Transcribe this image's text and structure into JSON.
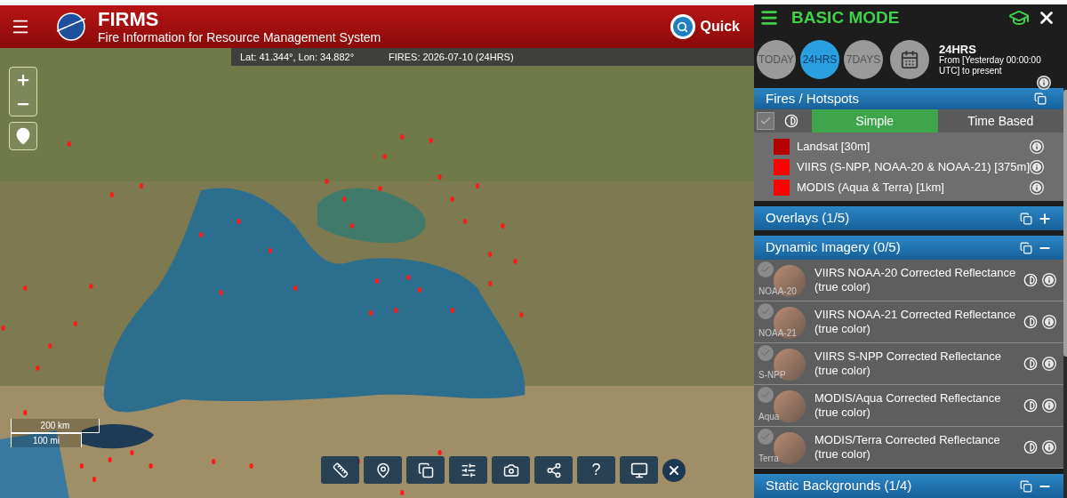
{
  "header": {
    "title": "FIRMS",
    "subtitle": "Fire Information for Resource Management System",
    "quick_search": "Quick"
  },
  "status": {
    "coords": "Lat: 41.344°, Lon: 34.882°",
    "fires": "FIRES: 2026-07-10 (24HRS)"
  },
  "scale": {
    "km": "200 km",
    "mi": "100 mi"
  },
  "toolbar": {
    "help_label": "?"
  },
  "panel": {
    "title": "BASIC MODE",
    "ranges": [
      {
        "label": "TODAY",
        "selected": false
      },
      {
        "label": "24HRS",
        "selected": true
      },
      {
        "label": "7DAYS",
        "selected": false
      }
    ],
    "range_title": "24HRS",
    "range_desc": "From [Yesterday 00:00:00 UTC] to present",
    "fires": {
      "title": "Fires / Hotspots",
      "checked": false,
      "modes": [
        {
          "label": "Simple",
          "selected": true
        },
        {
          "label": "Time Based",
          "selected": false
        }
      ],
      "layers": [
        {
          "name": "Landsat [30m]",
          "color": "#b30000"
        },
        {
          "name": "VIIRS (S-NPP, NOAA-20 & NOAA-21) [375m]",
          "color": "#ff0000"
        },
        {
          "name": "MODIS (Aqua & Terra) [1km]",
          "color": "#ff0000"
        }
      ]
    },
    "sections": [
      {
        "title": "Overlays (1/5)",
        "expanded": false
      },
      {
        "title": "Dynamic Imagery (0/5)",
        "expanded": true,
        "items": [
          {
            "badge": "NOAA-20",
            "name": "VIIRS NOAA-20 Corrected Reflectance (true color)",
            "checked": false
          },
          {
            "badge": "NOAA-21",
            "name": "VIIRS NOAA-21 Corrected Reflectance (true color)",
            "checked": false
          },
          {
            "badge": "S-NPP",
            "name": "VIIRS S-NPP Corrected Reflectance (true color)",
            "checked": false
          },
          {
            "badge": "Aqua",
            "name": "MODIS/Aqua Corrected Reflectance (true color)",
            "checked": false
          },
          {
            "badge": "Terra",
            "name": "MODIS/Terra Corrected Reflectance (true color)",
            "checked": false
          }
        ]
      },
      {
        "title": "Static Backgrounds (1/4)",
        "expanded": true
      }
    ]
  }
}
